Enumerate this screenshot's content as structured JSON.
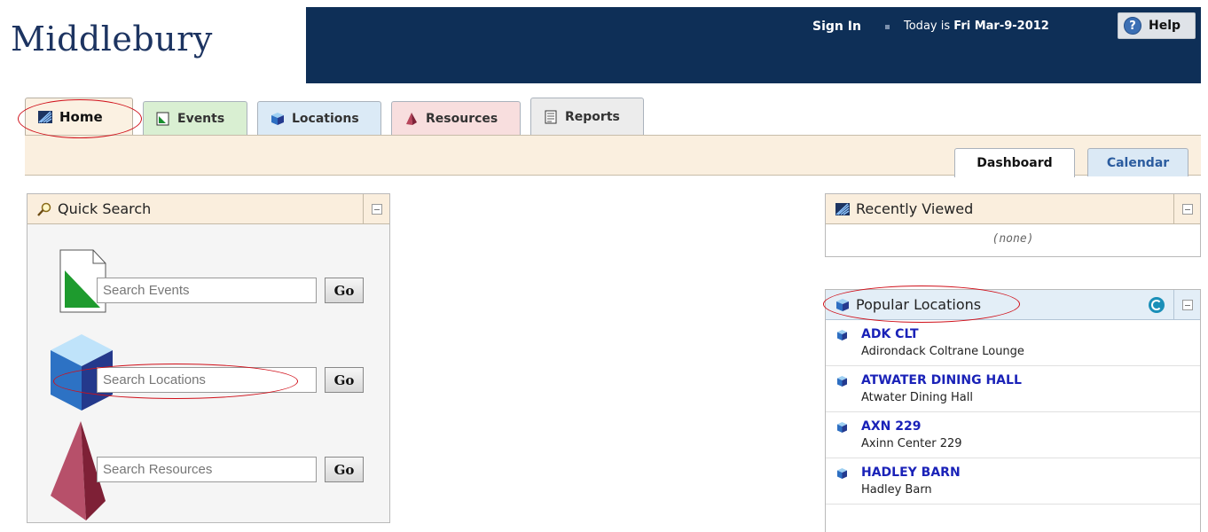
{
  "header": {
    "logo": "Middlebury",
    "signin": "Sign In",
    "today_prefix": "Today is",
    "today_date": "Fri Mar-9-2012",
    "help": "Help"
  },
  "tabs": [
    {
      "label": "Home"
    },
    {
      "label": "Events"
    },
    {
      "label": "Locations"
    },
    {
      "label": "Resources"
    },
    {
      "label": "Reports"
    }
  ],
  "subtabs": {
    "dashboard": "Dashboard",
    "calendar": "Calendar"
  },
  "quick_search": {
    "title": "Quick Search",
    "events_placeholder": "Search Events",
    "locations_placeholder": "Search Locations",
    "resources_placeholder": "Search Resources",
    "go": "Go"
  },
  "recently_viewed": {
    "title": "Recently Viewed",
    "empty": "(none)"
  },
  "popular_locations": {
    "title": "Popular Locations",
    "items": [
      {
        "name": "ADK CLT",
        "desc": "Adirondack Coltrane Lounge"
      },
      {
        "name": "ATWATER DINING HALL",
        "desc": "Atwater Dining Hall"
      },
      {
        "name": "AXN 229",
        "desc": "Axinn Center 229"
      },
      {
        "name": "HADLEY BARN",
        "desc": "Hadley Barn"
      }
    ]
  },
  "colors": {
    "topbar": "#0e2f57",
    "accent_oval": "#d0101a",
    "link": "#1a22b8"
  }
}
